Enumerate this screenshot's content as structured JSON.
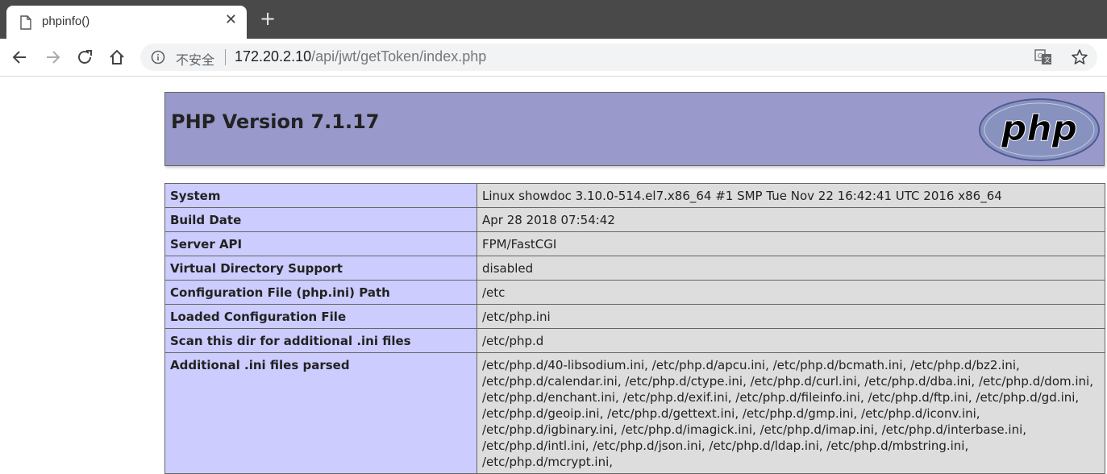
{
  "browser": {
    "tab_title": "phpinfo()",
    "close_symbol": "✕",
    "new_tab_symbol": "+",
    "insecure_label": "不安全",
    "url_host": "172.20.2.10",
    "url_path": "/api/jwt/getToken/index.php"
  },
  "page": {
    "title": "PHP Version 7.1.17",
    "logo_text": "php",
    "rows": [
      {
        "label": "System",
        "value": "Linux showdoc 3.10.0-514.el7.x86_64 #1 SMP Tue Nov 22 16:42:41 UTC 2016 x86_64"
      },
      {
        "label": "Build Date",
        "value": "Apr 28 2018 07:54:42"
      },
      {
        "label": "Server API",
        "value": "FPM/FastCGI"
      },
      {
        "label": "Virtual Directory Support",
        "value": "disabled"
      },
      {
        "label": "Configuration File (php.ini) Path",
        "value": "/etc"
      },
      {
        "label": "Loaded Configuration File",
        "value": "/etc/php.ini"
      },
      {
        "label": "Scan this dir for additional .ini files",
        "value": "/etc/php.d"
      },
      {
        "label": "Additional .ini files parsed",
        "value": "/etc/php.d/40-libsodium.ini, /etc/php.d/apcu.ini, /etc/php.d/bcmath.ini, /etc/php.d/bz2.ini, /etc/php.d/calendar.ini, /etc/php.d/ctype.ini, /etc/php.d/curl.ini, /etc/php.d/dba.ini, /etc/php.d/dom.ini, /etc/php.d/enchant.ini, /etc/php.d/exif.ini, /etc/php.d/fileinfo.ini, /etc/php.d/ftp.ini, /etc/php.d/gd.ini, /etc/php.d/geoip.ini, /etc/php.d/gettext.ini, /etc/php.d/gmp.ini, /etc/php.d/iconv.ini, /etc/php.d/igbinary.ini, /etc/php.d/imagick.ini, /etc/php.d/imap.ini, /etc/php.d/interbase.ini, /etc/php.d/intl.ini, /etc/php.d/json.ini, /etc/php.d/ldap.ini, /etc/php.d/mbstring.ini, /etc/php.d/mcrypt.ini,"
      }
    ]
  },
  "colors": {
    "header_bg": "#9999cc",
    "label_bg": "#ccccff",
    "value_bg": "#dddddd",
    "tabstrip_bg": "#494949"
  },
  "icons": [
    "page-icon",
    "close-icon",
    "back-icon",
    "forward-icon",
    "reload-icon",
    "home-icon",
    "info-icon",
    "translate-icon",
    "star-icon"
  ]
}
